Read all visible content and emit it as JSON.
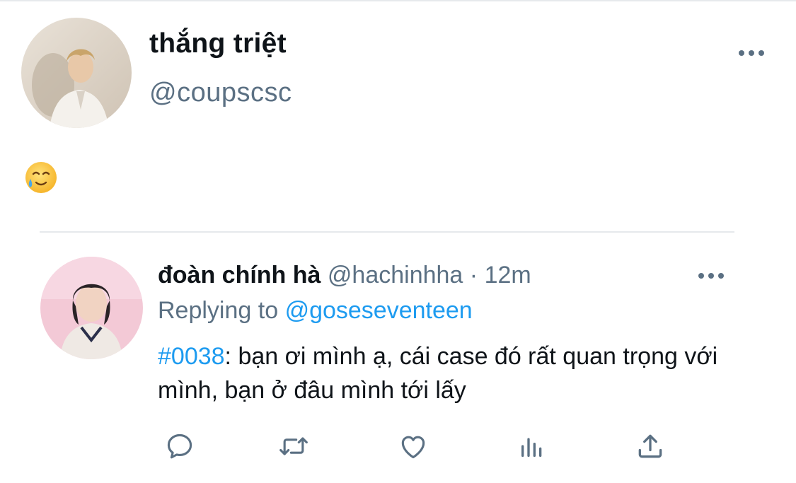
{
  "tweet": {
    "author_name": "thắng triệt",
    "author_handle": "@coupscsc",
    "content_emoji": "🥲",
    "more_icon": "more-horizontal-icon"
  },
  "reply": {
    "author_name": "đoàn chính hà",
    "author_handle": "@hachinhha",
    "separator": "·",
    "time": "12m",
    "replying_prefix": "Replying to",
    "replying_to": "@goseseventeen",
    "hashtag": "#0038",
    "text": ": bạn ơi mình ạ, cái case đó rất quan trọng với mình, bạn ở đâu mình tới lấy",
    "more_icon": "more-horizontal-icon"
  },
  "actions": [
    {
      "name": "reply",
      "icon": "comment-icon"
    },
    {
      "name": "retweet",
      "icon": "retweet-icon"
    },
    {
      "name": "like",
      "icon": "heart-icon"
    },
    {
      "name": "analytics",
      "icon": "bar-chart-icon"
    },
    {
      "name": "share",
      "icon": "share-icon"
    }
  ],
  "colors": {
    "text": "#0f1419",
    "secondary": "#5b7083",
    "link": "#1d9bf0",
    "divider": "#e6e9ec"
  }
}
